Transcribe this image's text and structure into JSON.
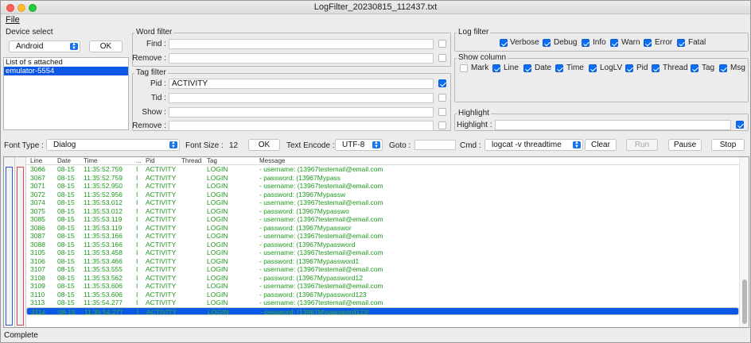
{
  "window": {
    "title": "LogFilter_20230815_112437.txt"
  },
  "menu": {
    "file": "File"
  },
  "device": {
    "group_label": "Device select",
    "selected": "Android",
    "ok_label": "OK",
    "list": [
      "List of s attached",
      "emulator-5554"
    ]
  },
  "word_filter": {
    "group_label": "Word filter",
    "find_label": "Find :",
    "find_value": "",
    "remove_label": "Remove :",
    "remove_value": ""
  },
  "tag_filter": {
    "group_label": "Tag filter",
    "pid_label": "Pid :",
    "pid_value": "ACTIVITY",
    "tid_label": "Tid :",
    "tid_value": "",
    "show_label": "Show :",
    "show_value": "",
    "remove_label": "Remove :",
    "remove_value": ""
  },
  "log_filter": {
    "group_label": "Log filter",
    "items": [
      {
        "label": "Verbose",
        "checked": true
      },
      {
        "label": "Debug",
        "checked": true
      },
      {
        "label": "Info",
        "checked": true
      },
      {
        "label": "Warn",
        "checked": true
      },
      {
        "label": "Error",
        "checked": true
      },
      {
        "label": "Fatal",
        "checked": true
      }
    ]
  },
  "show_column": {
    "group_label": "Show column",
    "items": [
      {
        "label": "Mark",
        "checked": false
      },
      {
        "label": "Line",
        "checked": true
      },
      {
        "label": "Date",
        "checked": true
      },
      {
        "label": "Time",
        "checked": true
      },
      {
        "label": "LogLV",
        "checked": true
      },
      {
        "label": "Pid",
        "checked": true
      },
      {
        "label": "Thread",
        "checked": true
      },
      {
        "label": "Tag",
        "checked": true
      },
      {
        "label": "Msg",
        "checked": true
      }
    ]
  },
  "highlight": {
    "group_label": "Highlight",
    "label": "Highlight :",
    "value": ""
  },
  "toolbar": {
    "font_type_label": "Font Type :",
    "font_type_value": "Dialog",
    "font_size_label": "Font Size :",
    "font_size_value": "12",
    "ok_label": "OK",
    "text_encode_label": "Text Encode :",
    "text_encode_value": "UTF-8",
    "goto_label": "Goto :",
    "goto_value": "",
    "cmd_label": "Cmd :",
    "cmd_value": "logcat -v threadtime",
    "clear_label": "Clear",
    "run_label": "Run",
    "pause_label": "Pause",
    "stop_label": "Stop"
  },
  "log_table": {
    "headers": [
      "Line",
      "Date",
      "Time",
      "...",
      "Pid",
      "Thread",
      "Tag",
      "Message"
    ],
    "rows": [
      {
        "line": "3066",
        "date": "08-15",
        "time": "11:35:52.759",
        "lv": "I",
        "pid": "ACTIVITY",
        "thread": "",
        "tag": "LOGIN",
        "msg": "- username: (13967testemail@email.com"
      },
      {
        "line": "3067",
        "date": "08-15",
        "time": "11:35:52.759",
        "lv": "I",
        "pid": "ACTIVITY",
        "thread": "",
        "tag": "LOGIN",
        "msg": "- password: (13967Mypass"
      },
      {
        "line": "3071",
        "date": "08-15",
        "time": "11:35:52.950",
        "lv": "I",
        "pid": "ACTIVITY",
        "thread": "",
        "tag": "LOGIN",
        "msg": "- username: (13967testemail@email.com"
      },
      {
        "line": "3072",
        "date": "08-15",
        "time": "11:35:52.956",
        "lv": "I",
        "pid": "ACTIVITY",
        "thread": "",
        "tag": "LOGIN",
        "msg": "- password: (13967Mypassw"
      },
      {
        "line": "3074",
        "date": "08-15",
        "time": "11:35:53.012",
        "lv": "I",
        "pid": "ACTIVITY",
        "thread": "",
        "tag": "LOGIN",
        "msg": "- username: (13967testemail@email.com"
      },
      {
        "line": "3075",
        "date": "08-15",
        "time": "11:35:53.012",
        "lv": "I",
        "pid": "ACTIVITY",
        "thread": "",
        "tag": "LOGIN",
        "msg": "- password: (13967Mypasswo"
      },
      {
        "line": "3085",
        "date": "08-15",
        "time": "11:35:53.119",
        "lv": "I",
        "pid": "ACTIVITY",
        "thread": "",
        "tag": "LOGIN",
        "msg": "- username: (13967testemail@email.com"
      },
      {
        "line": "3086",
        "date": "08-15",
        "time": "11:35:53.119",
        "lv": "I",
        "pid": "ACTIVITY",
        "thread": "",
        "tag": "LOGIN",
        "msg": "- password: (13967Mypasswor"
      },
      {
        "line": "3087",
        "date": "08-15",
        "time": "11:35:53.166",
        "lv": "I",
        "pid": "ACTIVITY",
        "thread": "",
        "tag": "LOGIN",
        "msg": "- username: (13967testemail@email.com"
      },
      {
        "line": "3088",
        "date": "08-15",
        "time": "11:35:53.166",
        "lv": "I",
        "pid": "ACTIVITY",
        "thread": "",
        "tag": "LOGIN",
        "msg": "- password: (13967Mypassword"
      },
      {
        "line": "3105",
        "date": "08-15",
        "time": "11:35:53.458",
        "lv": "I",
        "pid": "ACTIVITY",
        "thread": "",
        "tag": "LOGIN",
        "msg": "- username: (13967testemail@email.com"
      },
      {
        "line": "3106",
        "date": "08-15",
        "time": "11:35:53.466",
        "lv": "I",
        "pid": "ACTIVITY",
        "thread": "",
        "tag": "LOGIN",
        "msg": "- password: (13967Mypassword1"
      },
      {
        "line": "3107",
        "date": "08-15",
        "time": "11:35:53.555",
        "lv": "I",
        "pid": "ACTIVITY",
        "thread": "",
        "tag": "LOGIN",
        "msg": "- username: (13967testemail@email.com"
      },
      {
        "line": "3108",
        "date": "08-15",
        "time": "11:35:53.562",
        "lv": "I",
        "pid": "ACTIVITY",
        "thread": "",
        "tag": "LOGIN",
        "msg": "- password: (13967Mypassword12"
      },
      {
        "line": "3109",
        "date": "08-15",
        "time": "11:35:53.606",
        "lv": "I",
        "pid": "ACTIVITY",
        "thread": "",
        "tag": "LOGIN",
        "msg": "- username: (13967testemail@email.com"
      },
      {
        "line": "3110",
        "date": "08-15",
        "time": "11:35:53.606",
        "lv": "I",
        "pid": "ACTIVITY",
        "thread": "",
        "tag": "LOGIN",
        "msg": "- password: (13967Mypassword123"
      },
      {
        "line": "3113",
        "date": "08-15",
        "time": "11:35:54.277",
        "lv": "I",
        "pid": "ACTIVITY",
        "thread": "",
        "tag": "LOGIN",
        "msg": "- username: (13967testemail@email.com"
      },
      {
        "line": "3114",
        "date": "08-15",
        "time": "11:35:54.277",
        "lv": "I",
        "pid": "ACTIVITY",
        "thread": "",
        "tag": "LOGIN",
        "msg": "- password: (13967Mypassword123!"
      }
    ],
    "selected_index": 17
  },
  "status": {
    "text": "Complete"
  },
  "colors": {
    "accent": "#0a6cf0",
    "log_text": "#1d9a1d",
    "selection": "#0b57e6"
  }
}
